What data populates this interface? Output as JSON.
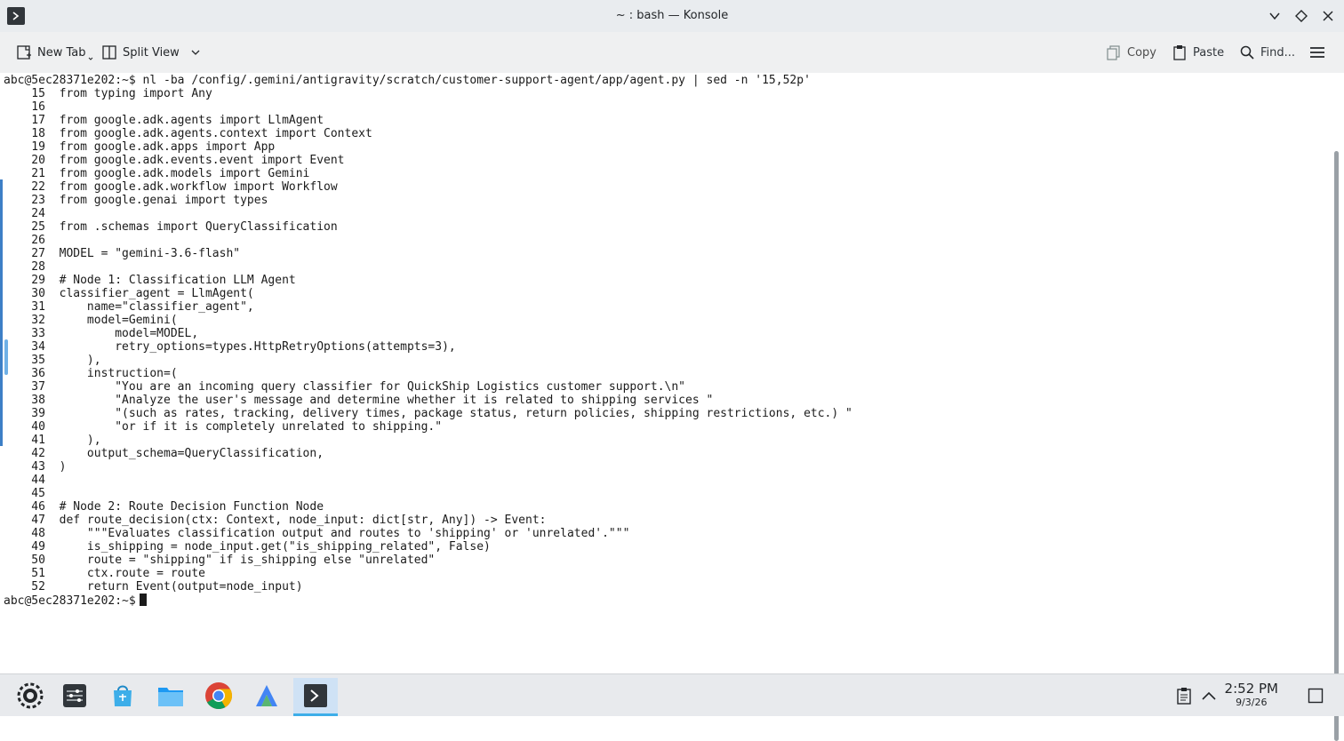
{
  "window": {
    "title": "~ : bash — Konsole"
  },
  "toolbar": {
    "new_tab_label": "New Tab",
    "split_view_label": "Split View",
    "copy_label": "Copy",
    "paste_label": "Paste",
    "find_label": "Find..."
  },
  "terminal": {
    "lines": [
      "abc@5ec28371e202:~$ nl -ba /config/.gemini/antigravity/scratch/customer-support-agent/app/agent.py | sed -n '15,52p'",
      "    15\tfrom typing import Any",
      "    16\t",
      "    17\tfrom google.adk.agents import LlmAgent",
      "    18\tfrom google.adk.agents.context import Context",
      "    19\tfrom google.adk.apps import App",
      "    20\tfrom google.adk.events.event import Event",
      "    21\tfrom google.adk.models import Gemini",
      "    22\tfrom google.adk.workflow import Workflow",
      "    23\tfrom google.genai import types",
      "    24\t",
      "    25\tfrom .schemas import QueryClassification",
      "    26\t",
      "    27\tMODEL = \"gemini-3.6-flash\"",
      "    28\t",
      "    29\t# Node 1: Classification LLM Agent",
      "    30\tclassifier_agent = LlmAgent(",
      "    31\t    name=\"classifier_agent\",",
      "    32\t    model=Gemini(",
      "    33\t        model=MODEL,",
      "    34\t        retry_options=types.HttpRetryOptions(attempts=3),",
      "    35\t    ),",
      "    36\t    instruction=(",
      "    37\t        \"You are an incoming query classifier for QuickShip Logistics customer support.\\n\"",
      "    38\t        \"Analyze the user's message and determine whether it is related to shipping services \"",
      "    39\t        \"(such as rates, tracking, delivery times, package status, return policies, shipping restrictions, etc.) \"",
      "    40\t        \"or if it is completely unrelated to shipping.\"",
      "    41\t    ),",
      "    42\t    output_schema=QueryClassification,",
      "    43\t)",
      "    44\t",
      "    45\t",
      "    46\t# Node 2: Route Decision Function Node",
      "    47\tdef route_decision(ctx: Context, node_input: dict[str, Any]) -> Event:",
      "    48\t    \"\"\"Evaluates classification output and routes to 'shipping' or 'unrelated'.\"\"\"",
      "    49\t    is_shipping = node_input.get(\"is_shipping_related\", False)",
      "    50\t    route = \"shipping\" if is_shipping else \"unrelated\"",
      "    51\t    ctx.route = route",
      "    52\t    return Event(output=node_input)"
    ],
    "prompt": "abc@5ec28371e202:~$"
  },
  "taskbar": {
    "apps": [
      "application-launcher-icon",
      "system-settings-icon",
      "discover-store-icon",
      "file-manager-icon",
      "chrome-browser-icon",
      "antigravity-app-icon",
      "konsole-terminal-icon"
    ],
    "clock_time": "2:52 PM",
    "clock_date": "9/3/26"
  },
  "colors": {
    "accent": "#3daee9",
    "terminal_bg": "#ffffff",
    "terminal_fg": "#1b1b1b"
  }
}
